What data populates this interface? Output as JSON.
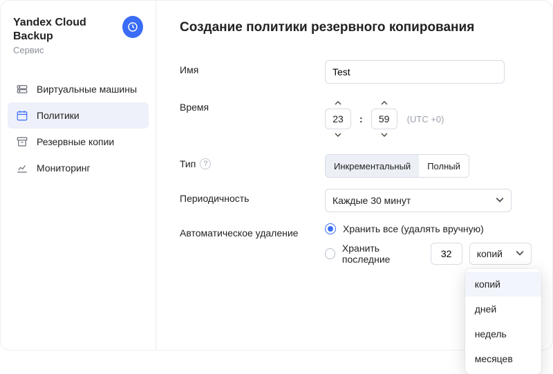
{
  "service": {
    "name": "Yandex Cloud Backup",
    "subtitle": "Сервис"
  },
  "sidebar": {
    "items": [
      {
        "label": "Виртуальные машины"
      },
      {
        "label": "Политики"
      },
      {
        "label": "Резервные копии"
      },
      {
        "label": "Мониторинг"
      }
    ],
    "active_index": 1
  },
  "page": {
    "title": "Создание политики резервного копирования"
  },
  "form": {
    "name": {
      "label": "Имя",
      "value": "Test"
    },
    "time": {
      "label": "Время",
      "hours": "23",
      "minutes": "59",
      "tz": "(UTC +0)"
    },
    "type": {
      "label": "Тип",
      "options": [
        "Инкрементальный",
        "Полный"
      ],
      "selected_index": 0
    },
    "periodicity": {
      "label": "Периодичность",
      "value": "Каждые 30 минут"
    },
    "retention": {
      "label": "Автоматическое удаление",
      "option_all": "Хранить все (удалять вручную)",
      "option_last": "Хранить последние",
      "selected": "all",
      "count": "32",
      "unit_selected": "копий",
      "unit_options": [
        "копий",
        "дней",
        "недель",
        "месяцев"
      ]
    }
  }
}
